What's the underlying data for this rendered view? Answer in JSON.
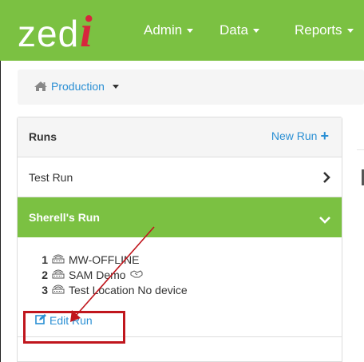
{
  "brand": {
    "text": "zed",
    "accent": "i"
  },
  "navbar": {
    "items": [
      {
        "label": "Admin"
      },
      {
        "label": "Data"
      },
      {
        "label": "Reports"
      }
    ]
  },
  "breadcrumb": {
    "label": "Production"
  },
  "runs_panel": {
    "title": "Runs",
    "new_run_label": "New Run",
    "runs": [
      {
        "label": "Test Run"
      },
      {
        "label": "Sherell's Run"
      }
    ],
    "locations": [
      {
        "num": "1",
        "name": "MW-OFFLINE"
      },
      {
        "num": "2",
        "name": "SAM Demo"
      },
      {
        "num": "3",
        "name": "Test Location No device"
      }
    ],
    "edit_run_label": "Edit Run"
  },
  "colors": {
    "brand_green": "#7bc142",
    "link_blue": "#2a8fd4",
    "logo_red": "#d7263d",
    "annotation_red": "#c0161d"
  },
  "icons": [
    "home-icon",
    "caret-down-icon",
    "plus-icon",
    "chevron-right-icon",
    "chevron-down-icon",
    "device-icon",
    "handshake-icon",
    "edit-icon"
  ]
}
